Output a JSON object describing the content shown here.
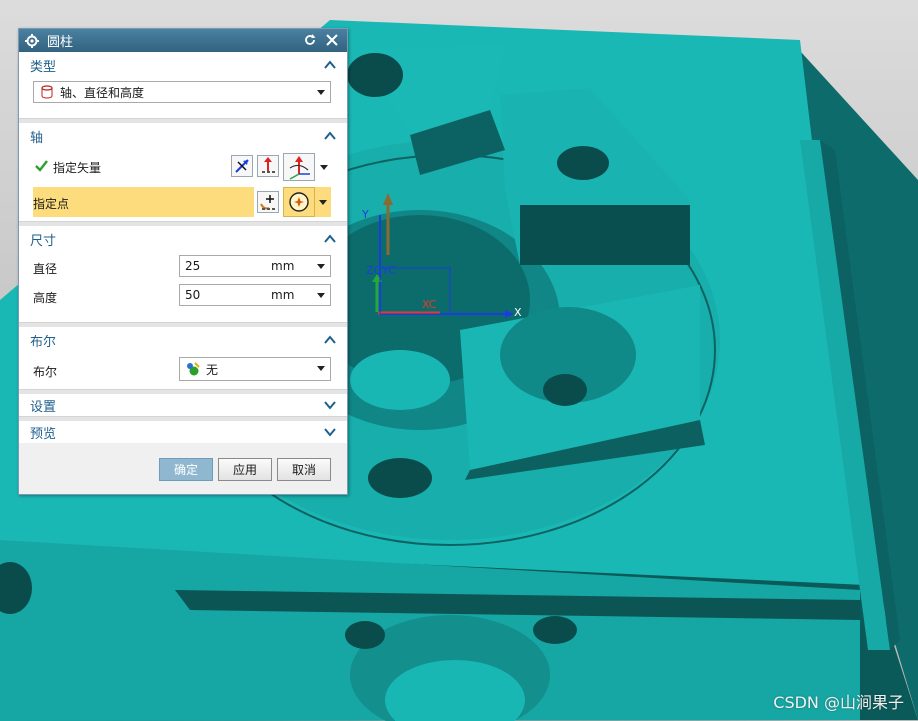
{
  "dialog": {
    "title": "圆柱",
    "reset_icon": "reset-icon",
    "close_icon": "close-icon"
  },
  "sections": {
    "type": {
      "label": "类型",
      "value": "轴、直径和高度"
    },
    "axis": {
      "label": "轴",
      "specify_vector": "指定矢量",
      "specify_point": "指定点"
    },
    "dimensions": {
      "label": "尺寸",
      "diameter_label": "直径",
      "diameter_value": "25",
      "diameter_unit": "mm",
      "height_label": "高度",
      "height_value": "50",
      "height_unit": "mm"
    },
    "boolean": {
      "label": "布尔",
      "row_label": "布尔",
      "value": "无"
    },
    "settings": {
      "label": "设置"
    },
    "preview": {
      "label": "预览"
    }
  },
  "buttons": {
    "ok": "确定",
    "apply": "应用",
    "cancel": "取消"
  },
  "viewport": {
    "axis_labels": {
      "y": "Y",
      "zc": "ZC",
      "yc": "YC",
      "xc": "XC",
      "x": "X"
    },
    "watermark": "CSDN @山涧果子"
  },
  "colors": {
    "model": "#19b5b3",
    "model_dark": "#0b5858",
    "accent_title": "#3c6f8f",
    "section_text": "#1e5f8c",
    "highlight_row": "#fcdc7c"
  }
}
